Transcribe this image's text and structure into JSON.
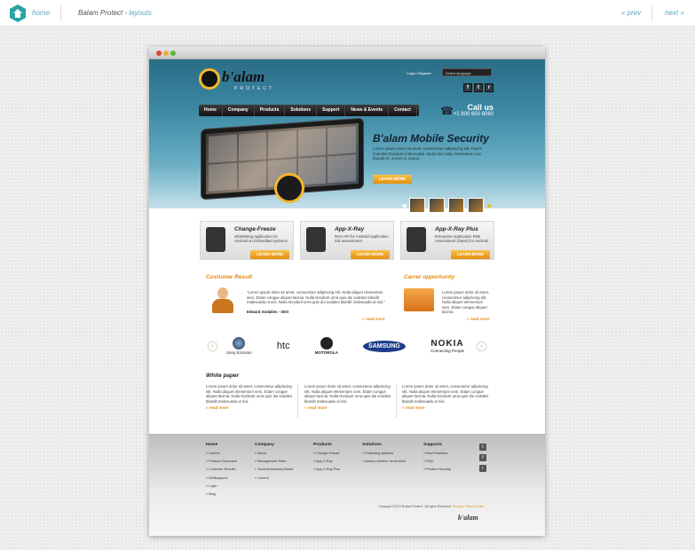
{
  "topbar": {
    "home": "home",
    "title_main": "Balam Protect - ",
    "title_sub": "layouts",
    "prev": "« prev",
    "next": "next »"
  },
  "header": {
    "logo_word": "b'alam",
    "logo_sub": "PROTECT",
    "login": "Login / Register",
    "lang": "Select language",
    "call_us": "Call us",
    "phone": "+1 800 600 6060"
  },
  "nav": [
    "Home",
    "Company",
    "Products",
    "Solutions",
    "Support",
    "News & Events",
    "Contact"
  ],
  "hero": {
    "title": "B'alam Mobile Security",
    "text": "Lorem ipsum dolor sit amet, consectetur adipiscing elit. Fusce molestie tincidunt malesuada. Morbi dui nulla, fermentum non blandit et, ornare in neque.",
    "button": "LEARN MORE"
  },
  "features": [
    {
      "title": "Change-Freeze",
      "desc": "whitelisting application for Android on Embedded systems",
      "button": "LEARN MORE"
    },
    {
      "title": "App-X-Ray",
      "desc": "Rest API for Android Application risk assessment",
      "button": "LEARN MORE"
    },
    {
      "title": "App-X-Ray Plus",
      "desc": "Enterprise Application Risk Assessment (SaaS) for Android",
      "button": "LEARN MORE"
    }
  ],
  "customer": {
    "title": "Costumer Result",
    "quote": "\"Lorem ipsum dolor sit amet, consectetur adipiscing elit. Nulla aliquet elementum sem. Etiam congue aliquet lacinia. Nulla tincidunt urna quis dui sodales blandit malesuada ut nisi. Nulla tincidunt urna quis dui sodales blandit malesuada ut nisi.\"",
    "author": "Edward Sodalies - SEO",
    "more": "» read more"
  },
  "career": {
    "title": "Carrer opportunity",
    "text": "Lorem ipsum dolor sit amet, consectetur adipiscing elit. Nulla aliquet elementum sem. Etiam congue aliquet lacinia.",
    "more": "» read more"
  },
  "brands": [
    "Sony Ericsson",
    "htc",
    "MOTOROLA",
    "SAMSUNG",
    "NOKIA",
    "Connecting People"
  ],
  "whitepaper": {
    "title": "White paper",
    "cols": [
      {
        "text": "Lorem ipsum dolor sit amet, consectetur adipiscing elit. Nulla aliquet elementum sem. Etiam congue aliquet lacinia. Nulla tincidunt urna quis dui sodales blandit malesuada ut nisi.",
        "more": "» read more"
      },
      {
        "text": "Lorem ipsum dolor sit amet, consectetur adipiscing elit. Nulla aliquet elementum sem. Etiam congue aliquet lacinia. Nulla tincidunt urna quis dui sodales blandit malesuada ut nisi.",
        "more": "» read more"
      },
      {
        "text": "Lorem ipsum dolor sit amet, consectetur adipiscing elit. Nulla aliquet elementum sem. Etiam congue aliquet lacinia. Nulla tincidunt urna quis dui sodales blandit malesuada ut nisi.",
        "more": "» read more"
      }
    ]
  },
  "footer": {
    "cols": [
      {
        "h": "Home",
        "items": [
          "» Carrers",
          "» Product Showcase",
          "» Customer Results",
          "» Whitepapers",
          "» Login",
          "» Blog"
        ]
      },
      {
        "h": "Company",
        "items": [
          "» About",
          "» Management Team",
          "» Tecnical Advisory Board",
          "» Carrers"
        ]
      },
      {
        "h": "Products",
        "items": [
          "» Change-Freeze",
          "» App-X-Ray",
          "» App-X-Ray Plus"
        ]
      },
      {
        "h": "Solutions",
        "items": [
          "» Protecting systems",
          "» Assess whether an Android"
        ]
      },
      {
        "h": "Supports",
        "items": [
          "» Best Practices",
          "» FAQ",
          "» Product Security"
        ]
      }
    ],
    "copyright": "Copyright ©2011 B'alam Protect . All rights Reserved.",
    "links": "Privacy | Terms of Use",
    "logo": "b'alam"
  },
  "colors": {
    "accent": "#e08a14",
    "teal": "#3d8aa6"
  }
}
